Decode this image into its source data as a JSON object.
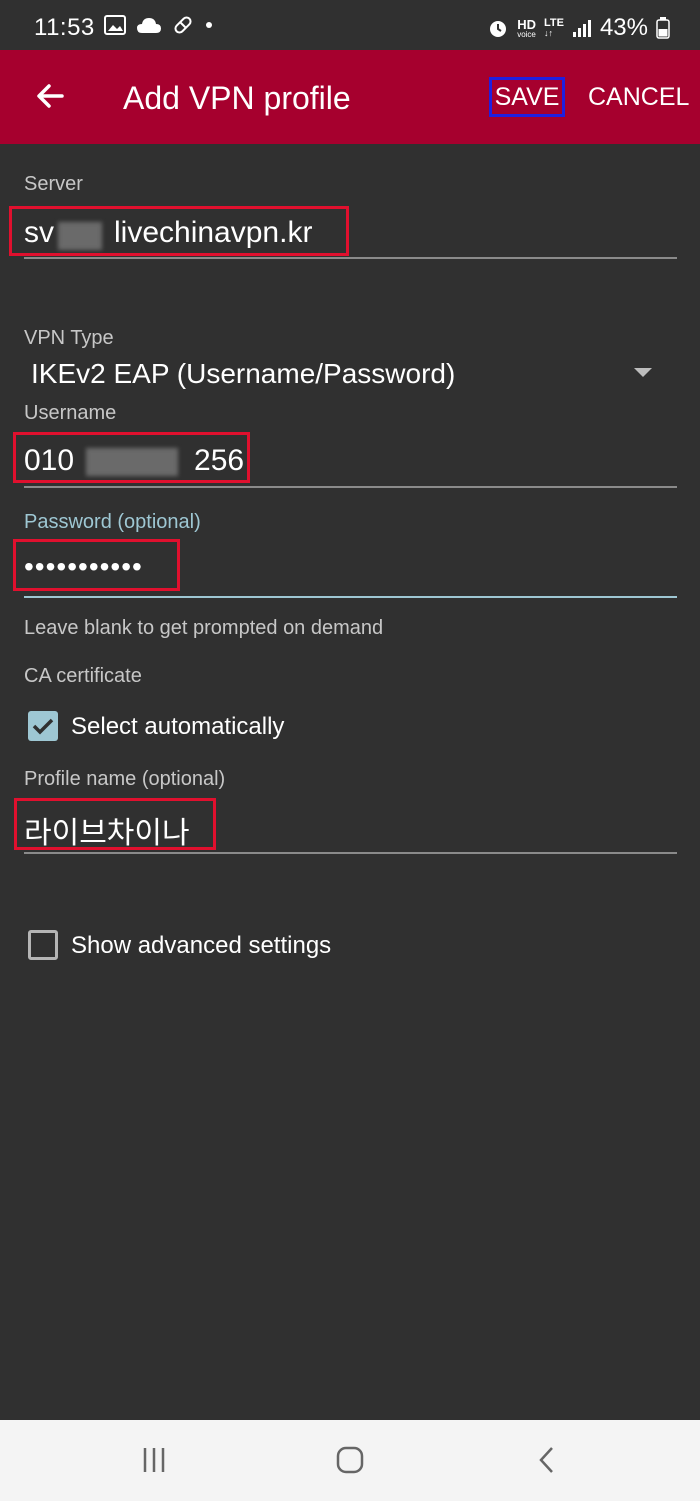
{
  "status_bar": {
    "time": "11:53",
    "battery": "43%",
    "hd_label": "HD",
    "voice_label": "voice",
    "lte_label": "LTE"
  },
  "app_bar": {
    "title": "Add VPN profile",
    "save_label": "SAVE",
    "cancel_label": "CANCEL",
    "color": "#a6002e"
  },
  "form": {
    "server": {
      "label": "Server",
      "value": "sv  livechinavpn.kr"
    },
    "vpn_type": {
      "label": "VPN Type",
      "value": "IKEv2 EAP (Username/Password)"
    },
    "username": {
      "label": "Username",
      "value": "010    256"
    },
    "password": {
      "label": "Password (optional)",
      "value": "•••••••••••",
      "helper": "Leave blank to get prompted on demand"
    },
    "ca_certificate": {
      "label": "CA certificate",
      "select_auto_label": "Select automatically",
      "select_auto_checked": true
    },
    "profile_name": {
      "label": "Profile name (optional)",
      "value": "라이브차이나"
    },
    "advanced": {
      "label": "Show advanced settings",
      "checked": false
    }
  },
  "colors": {
    "accent": "#9ec7d3",
    "highlight_red": "#e0102e",
    "highlight_blue": "#1f1fe0",
    "background": "#303030"
  },
  "icons": {
    "back": "arrow-left-icon",
    "dropdown": "triangle-down-icon",
    "nav_recent": "recent-apps-icon",
    "nav_home": "home-icon",
    "nav_back": "back-chevron-icon"
  }
}
